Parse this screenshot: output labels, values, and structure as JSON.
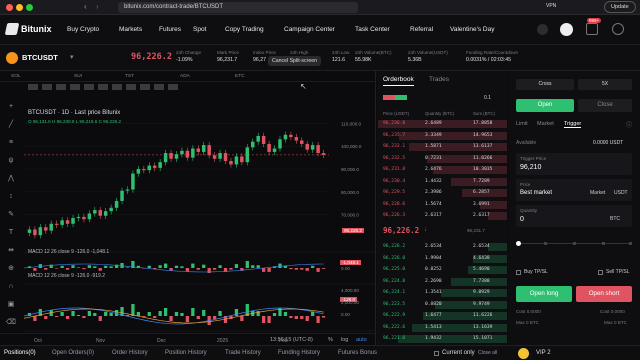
{
  "browser": {
    "url": "bitunix.com/contract-trade/BTCUSDT",
    "vpn": "VPN",
    "update": "Update"
  },
  "nav": {
    "logo": "Bitunix",
    "items": [
      "Buy Crypto",
      "Markets",
      "Futures",
      "Spot",
      "Copy Trading",
      "Campaign Center",
      "Task Center",
      "Referral",
      "Valentine's Day"
    ],
    "badge": "999+"
  },
  "ticker": {
    "symbol": "BTCUSDT",
    "price": "96,226.2",
    "stats": [
      {
        "label": "24h Change",
        "value": "-1.09%"
      },
      {
        "label": "Mark Price",
        "value": "96,231.7"
      },
      {
        "label": "Index Price",
        "value": "96,27"
      },
      {
        "label": "24h High",
        "value": ""
      },
      {
        "label": "24h Low",
        "value": "121.6"
      },
      {
        "label": "24h Volume(BTC)",
        "value": "55.98K"
      },
      {
        "label": "24h Volume(USDT)",
        "value": "5.36B"
      },
      {
        "label": "Funding Rate/Countdown",
        "value": "0.0031% / 02:03:45"
      }
    ],
    "tooltip": "Cancel Split-screen"
  },
  "chart": {
    "pairs": [
      "SOL",
      "SUI",
      "TST",
      "ADA",
      "ETC"
    ],
    "legend": "BTCUSDT · 1D · Last price Bitunix",
    "ohlc": "O 96,131.6 H 96,239.9 L 96,219.6 C 96,226.2",
    "macd1": "MACD 12 26 close 9  -126.0  -1,048.1",
    "macd2": "MACD 12 26 close 9  -126.0  -919.2",
    "price_tag": "96,226.2",
    "macd_tag1": "-1,048.1",
    "macd_tag2": "-126.0",
    "x_labels": [
      "Oct",
      "Nov",
      "Dec",
      "2025",
      "Feb"
    ],
    "y_labels": [
      "110,000.0",
      "100,000.0",
      "90,000.0",
      "80,000.0",
      "70,000.0"
    ],
    "macd_y1": [
      "0.00"
    ],
    "macd_y2": [
      "4,000.00",
      "2,000.00",
      "0.00"
    ],
    "time": "13:56:15 (UTC-8)",
    "pct": "%",
    "log": "log",
    "auto": "auto",
    "chart_data": {
      "type": "candlestick",
      "x": [
        "Oct",
        "Nov",
        "Dec",
        "2025",
        "Feb"
      ],
      "values": [
        62000,
        63500,
        61000,
        64500,
        63000,
        66000,
        65500,
        67500,
        66000,
        68500,
        69000,
        68000,
        70500,
        72000,
        69500,
        71500,
        73000,
        76000,
        80500,
        81000,
        88000,
        90000,
        89500,
        91500,
        90500,
        93000,
        97000,
        94500,
        96500,
        98000,
        95000,
        99000,
        97500,
        100500,
        96000,
        94500,
        97000,
        93500,
        92000,
        95500,
        93000,
        99500,
        102000,
        104500,
        101000,
        97500,
        99000,
        103000,
        105000,
        104000,
        102500,
        101000,
        98500,
        100500,
        97000,
        96200
      ],
      "ylim": [
        58000,
        115000
      ]
    }
  },
  "orderbook": {
    "tabs": [
      "Orderbook",
      "Trades"
    ],
    "headers": [
      "Price (USDT)",
      "Quantity (BTC)",
      "Sum (BTC)"
    ],
    "precision": "0.1",
    "asks": [
      [
        "96,236.8",
        "2.6489",
        "17.8858"
      ],
      [
        "96,235.7",
        "3.3349",
        "14.9653"
      ],
      [
        "96,233.1",
        "1.5871",
        "13.6137"
      ],
      [
        "96,232.5",
        "0.7231",
        "11.0266"
      ],
      [
        "96,231.8",
        "2.6476",
        "10.3035"
      ],
      [
        "96,230.4",
        "1.4432",
        "7.7289"
      ],
      [
        "96,229.5",
        "2.3986",
        "6.2857"
      ],
      [
        "96,228.6",
        "1.5674",
        "3.6991"
      ],
      [
        "96,226.3",
        "2.6317",
        "2.6317"
      ]
    ],
    "last": "96,226.2",
    "mark": "96,231.7",
    "bids": [
      [
        "96,226.2",
        "2.6534",
        "2.6534"
      ],
      [
        "96,226.0",
        "1.9904",
        "4.6438"
      ],
      [
        "96,225.0",
        "0.8252",
        "5.4690"
      ],
      [
        "96,224.8",
        "2.2698",
        "7.7388"
      ],
      [
        "96,224.1",
        "1.3541",
        "9.0929"
      ],
      [
        "96,223.5",
        "0.8820",
        "9.9749"
      ],
      [
        "96,222.9",
        "1.6477",
        "11.6226"
      ],
      [
        "96,222.6",
        "1.5413",
        "13.1639"
      ],
      [
        "96,221.0",
        "1.9432",
        "15.1071"
      ]
    ]
  },
  "trade": {
    "margin": "Cross",
    "leverage": "5X",
    "open": "Open",
    "close": "Close",
    "order_types": [
      "Limit",
      "Market",
      "Trigger"
    ],
    "available_label": "Available",
    "available": "0.0000 USDT",
    "trigger_label": "Trigger Price",
    "trigger_value": "96,210",
    "price_label": "Price",
    "price_value": "Best market",
    "market": "Market",
    "last": "USDT",
    "qty_label": "Quantity",
    "qty_value": "0",
    "qty_unit": "BTC",
    "tpsl": "Buy TP/SL",
    "tpsl2": "Sell TP/SL",
    "long": "Open long",
    "short": "Open short",
    "cost_l": "Cost 0.0000",
    "cost_s": "Cost 0.0000",
    "max_l": "Max 0 BTC",
    "max_s": "Max 0 BTC",
    "vip": "VIP 2"
  },
  "bottom": {
    "tabs": [
      "Positions(0)",
      "Open Orders(0)",
      "Order History",
      "Position History",
      "Trade History",
      "Funding History",
      "Futures Bonus"
    ],
    "current_only": "Current only",
    "close_all": "Close all"
  }
}
